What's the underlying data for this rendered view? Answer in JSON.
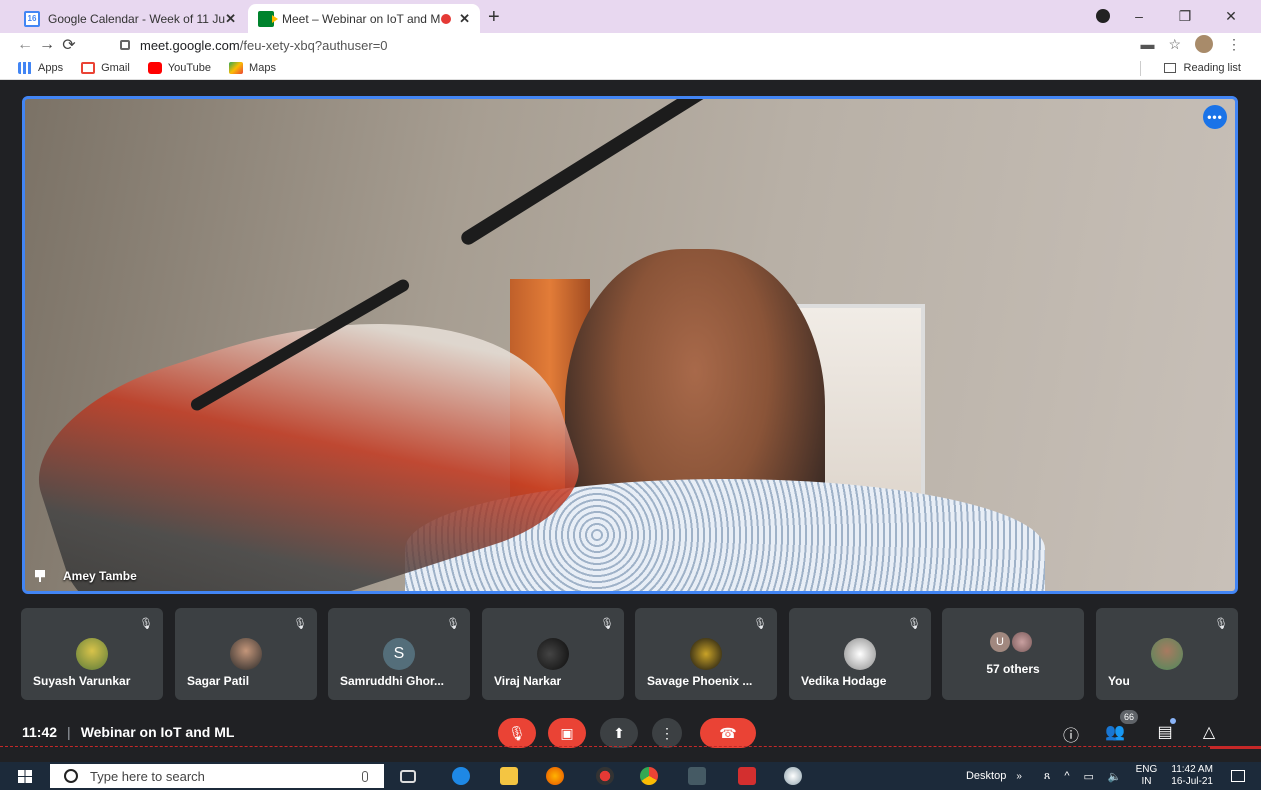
{
  "browser": {
    "tabs": [
      {
        "title": "Google Calendar - Week of 11 Ju",
        "favicon": "calendar-icon",
        "favicon_text": "16"
      },
      {
        "title": "Meet – Webinar on IoT and M",
        "favicon": "meet-icon",
        "recording": true
      }
    ],
    "new_tab": "+",
    "window_controls": {
      "minimize": "–",
      "maximize": "❐",
      "close": "✕"
    },
    "url": {
      "domain": "meet.google.com",
      "path": "/feu-xety-xbq?authuser=0"
    },
    "bookmarks": [
      {
        "label": "Apps",
        "icon": "apps-icon"
      },
      {
        "label": "Gmail",
        "icon": "gmail-icon"
      },
      {
        "label": "YouTube",
        "icon": "youtube-icon"
      },
      {
        "label": "Maps",
        "icon": "maps-icon"
      }
    ],
    "reading_list": "Reading list"
  },
  "meet": {
    "main_speaker": "Amey Tambe",
    "participants": [
      {
        "name": "Suyash Varunkar",
        "avatar": "photo"
      },
      {
        "name": "Sagar Patil",
        "avatar": "photo"
      },
      {
        "name": "Samruddhi Ghor...",
        "avatar": "letter",
        "initial": "S"
      },
      {
        "name": "Viraj Narkar",
        "avatar": "photo"
      },
      {
        "name": "Savage Phoenix ...",
        "avatar": "photo"
      },
      {
        "name": "Vedika Hodage",
        "avatar": "photo"
      },
      {
        "name": "You",
        "avatar": "photo"
      }
    ],
    "others": {
      "count_label": "57 others",
      "initial": "U"
    },
    "time": "11:42",
    "separator": "|",
    "meeting_title": "Webinar on IoT and ML",
    "people_badge": "66",
    "colors": {
      "accent": "#1a73e8",
      "danger": "#ea4335",
      "tile": "#3c4043",
      "bg": "#202124"
    }
  },
  "taskbar": {
    "search_placeholder": "Type here to search",
    "desktop": "Desktop",
    "overflow": "»",
    "lang_top": "ENG",
    "lang_bottom": "IN",
    "time": "11:42 AM",
    "date": "16-Jul-21"
  }
}
